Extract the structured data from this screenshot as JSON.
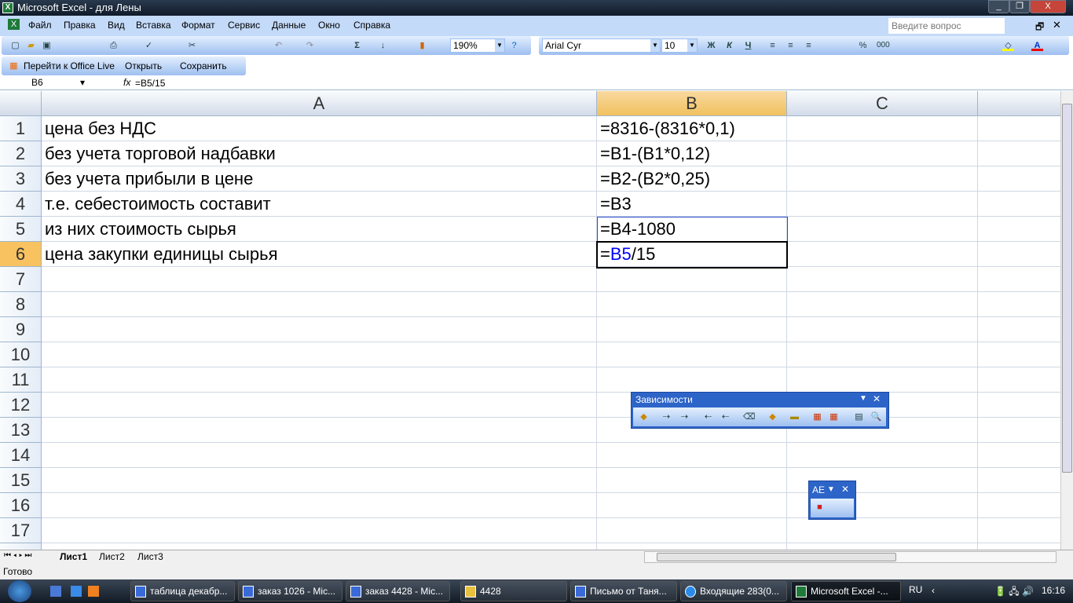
{
  "window": {
    "title": "Microsoft Excel - для Лены",
    "min": "_",
    "restore": "❐",
    "close": "X"
  },
  "menu": {
    "items": [
      "Файл",
      "Правка",
      "Вид",
      "Вставка",
      "Формат",
      "Сервис",
      "Данные",
      "Окно",
      "Справка"
    ],
    "ask_placeholder": "Введите вопрос"
  },
  "toolbar": {
    "zoom": "190%",
    "font": "Arial Cyr",
    "size": "10",
    "bold": "Ж",
    "italic": "К",
    "underline": "Ч",
    "percent": "%",
    "thousands": "000"
  },
  "office_live": {
    "goto": "Перейти к Office Live",
    "open": "Открыть",
    "save": "Сохранить"
  },
  "formula_bar": {
    "name_box": "B6",
    "fx": "fx",
    "formula": "=B5/15"
  },
  "columns": [
    "A",
    "B",
    "C"
  ],
  "rows": [
    {
      "n": "1",
      "a": "цена без НДС",
      "b": "=8316-(8316*0,1)"
    },
    {
      "n": "2",
      "a": "без учета торговой надбавки",
      "b": "=B1-(B1*0,12)"
    },
    {
      "n": "3",
      "a": "без учета прибыли в цене",
      "b": "=B2-(B2*0,25)"
    },
    {
      "n": "4",
      "a": "т.е. себестоимость составит",
      "b": "=B3"
    },
    {
      "n": "5",
      "a": "из них стоимость сырья",
      "b": "=B4-1080"
    },
    {
      "n": "6",
      "a": "цена закупки единицы сырья",
      "b_prefix": "=",
      "b_ref": "B5",
      "b_suffix": "/15"
    },
    {
      "n": "7"
    },
    {
      "n": "8"
    },
    {
      "n": "9"
    },
    {
      "n": "10"
    },
    {
      "n": "11"
    },
    {
      "n": "12"
    },
    {
      "n": "13"
    },
    {
      "n": "14"
    },
    {
      "n": "15"
    },
    {
      "n": "16"
    },
    {
      "n": "17"
    }
  ],
  "dependencies_toolbar": {
    "title": "Зависимости"
  },
  "small_toolbar": {
    "title": "АЕ"
  },
  "sheets": [
    "Лист1",
    "Лист2",
    "Лист3"
  ],
  "status": "Готово",
  "taskbar": {
    "tasks": [
      "таблица декабр...",
      "заказ 1026 - Mic...",
      "заказ 4428 - Mic...",
      "4428",
      "Письмо от Таня...",
      "Входящие 283(0...",
      "Microsoft Excel -..."
    ],
    "lang": "RU",
    "time": "16:16"
  },
  "colors": {
    "ref_blue": "#0000ff",
    "selected_header": "#f7c25f",
    "toolbar_blue": "#c3daf9"
  }
}
